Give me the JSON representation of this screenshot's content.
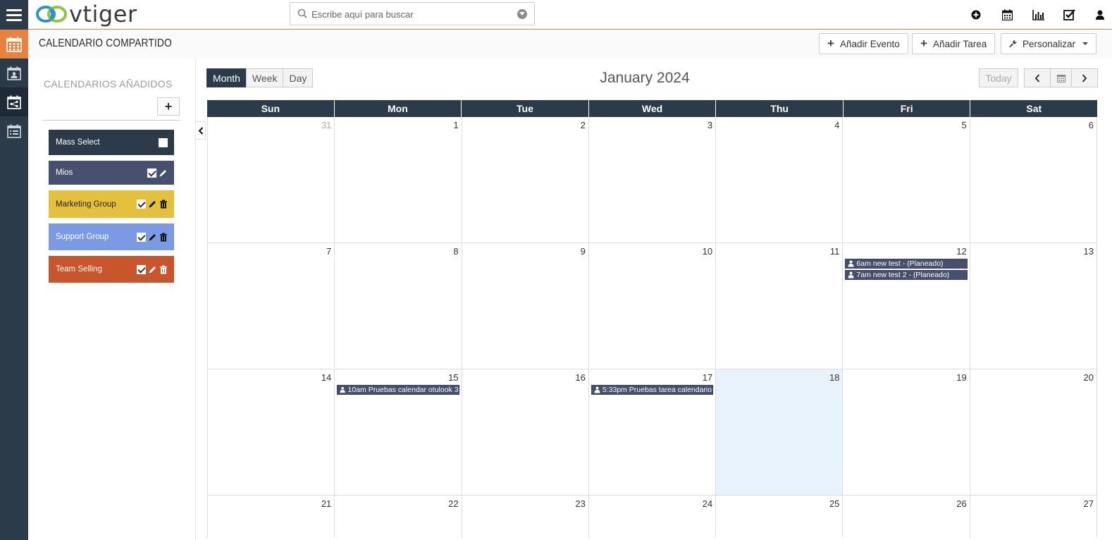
{
  "app": {
    "logo_text": "vtiger"
  },
  "search": {
    "placeholder": "Escribe aquí para buscar"
  },
  "top_icons": [
    "plus-circle-icon",
    "calendar-icon",
    "bar-chart-icon",
    "checkbox-icon",
    "user-icon"
  ],
  "rail_icons": [
    "calendar-grid-icon",
    "calendar-person-icon",
    "shared-calendar-icon",
    "calendar-list-icon"
  ],
  "module": {
    "title": "CALENDARIO COMPARTIDO",
    "add_event": "Añadir Evento",
    "add_task": "Añadir Tarea",
    "customize": "Personalizar"
  },
  "sidebar": {
    "title": "CALENDARIOS AÑADIDOS",
    "add": "+",
    "calendars": [
      {
        "label": "Mass Select",
        "color": "#2c3b49",
        "checked": false,
        "edit": false,
        "delete": false
      },
      {
        "label": "Mios",
        "color": "#47506f",
        "checked": true,
        "edit": true,
        "delete": false
      },
      {
        "label": "Marketing Group",
        "color": "#e4c03d",
        "checked": true,
        "edit": true,
        "delete": true
      },
      {
        "label": "Support Group",
        "color": "#7a9be3",
        "checked": true,
        "edit": true,
        "delete": true
      },
      {
        "label": "Team Selling",
        "color": "#c9552c",
        "checked": true,
        "edit": true,
        "delete": true
      }
    ]
  },
  "calendar": {
    "views": [
      "Month",
      "Week",
      "Day"
    ],
    "active_view": "Month",
    "title": "January 2024",
    "today": "Today",
    "weekdays": [
      "Sun",
      "Mon",
      "Tue",
      "Wed",
      "Thu",
      "Fri",
      "Sat"
    ],
    "weeks": [
      [
        {
          "d": "31",
          "other": true
        },
        {
          "d": "1"
        },
        {
          "d": "2"
        },
        {
          "d": "3"
        },
        {
          "d": "4"
        },
        {
          "d": "5"
        },
        {
          "d": "6"
        }
      ],
      [
        {
          "d": "7"
        },
        {
          "d": "8"
        },
        {
          "d": "9"
        },
        {
          "d": "10"
        },
        {
          "d": "11"
        },
        {
          "d": "12",
          "events": [
            "6am new test - (Planeado)",
            "7am new test 2 - (Planeado)"
          ]
        },
        {
          "d": "13"
        }
      ],
      [
        {
          "d": "14"
        },
        {
          "d": "15",
          "events": [
            "10am Pruebas calendar otulook 3"
          ]
        },
        {
          "d": "16"
        },
        {
          "d": "17",
          "events": [
            "5:33pm Pruebas tarea calendario"
          ]
        },
        {
          "d": "18",
          "today": true
        },
        {
          "d": "19"
        },
        {
          "d": "20"
        }
      ],
      [
        {
          "d": "21"
        },
        {
          "d": "22"
        },
        {
          "d": "23"
        },
        {
          "d": "24"
        },
        {
          "d": "25"
        },
        {
          "d": "26"
        },
        {
          "d": "27"
        }
      ]
    ]
  }
}
